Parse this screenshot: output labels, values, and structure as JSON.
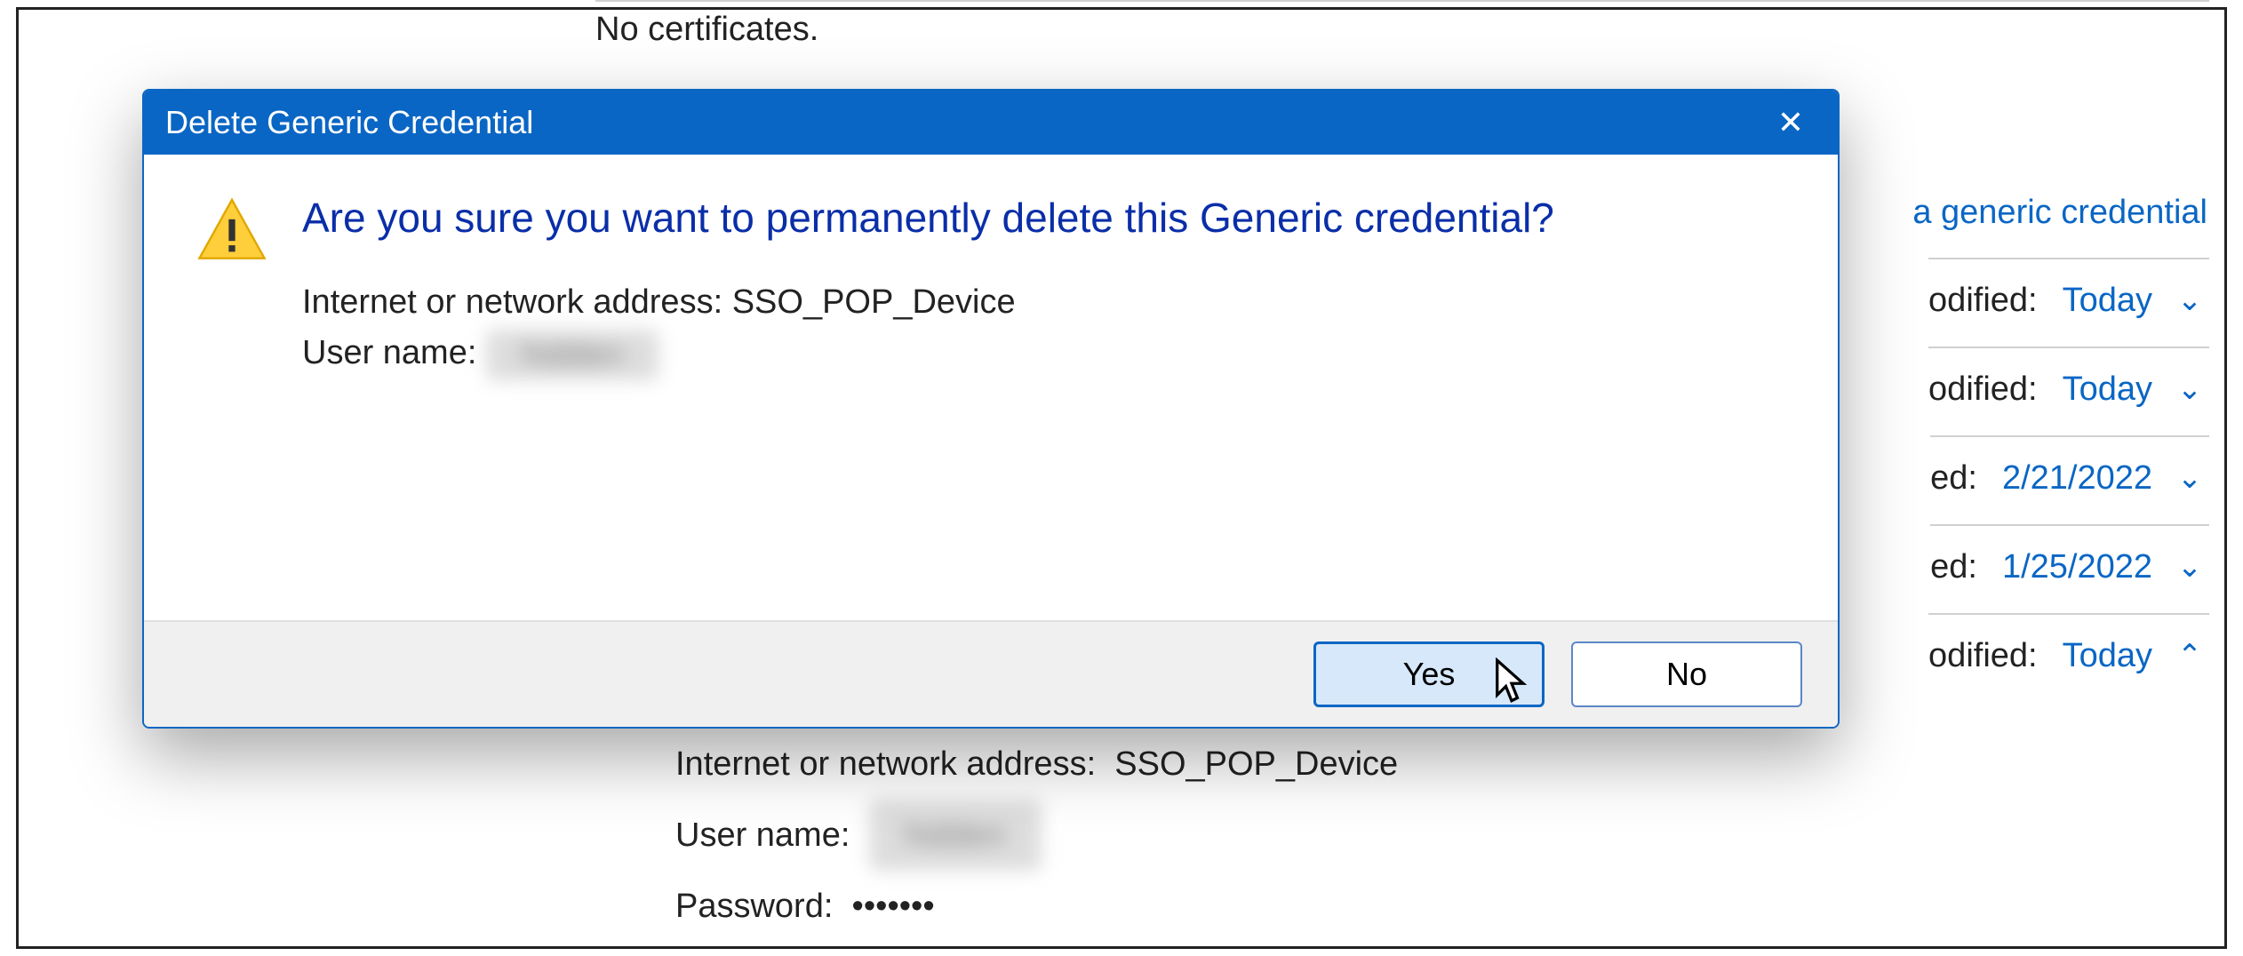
{
  "background": {
    "no_certificates": "No certificates.",
    "add_generic_link": "a generic credential",
    "rows": [
      {
        "label_fragment": "odified:",
        "value": "Today",
        "expanded": false
      },
      {
        "label_fragment": "odified:",
        "value": "Today",
        "expanded": false
      },
      {
        "label_fragment": "ed:",
        "value": "2/21/2022",
        "expanded": false
      },
      {
        "label_fragment": "ed:",
        "value": "1/25/2022",
        "expanded": false
      },
      {
        "label_fragment": "odified:",
        "value": "Today",
        "expanded": true
      }
    ],
    "detail": {
      "address_label": "Internet or network address:",
      "address_value": "SSO_POP_Device",
      "user_label": "User name:",
      "password_label": "Password:",
      "password_value": "•••••••"
    }
  },
  "dialog": {
    "title": "Delete Generic Credential",
    "question": "Are you sure you want to permanently delete this Generic credential?",
    "address_label": "Internet or network address:",
    "address_value": "SSO_POP_Device",
    "user_label": "User name:",
    "yes": "Yes",
    "no": "No"
  }
}
